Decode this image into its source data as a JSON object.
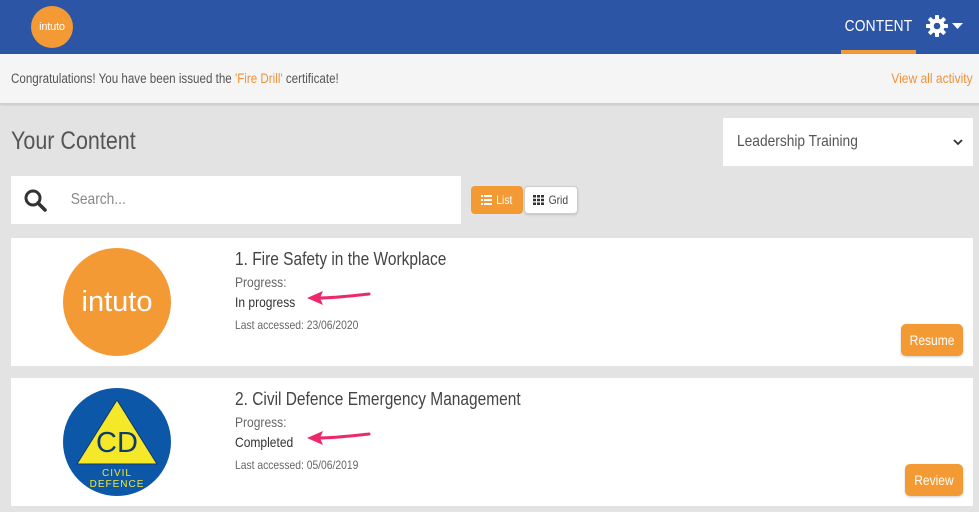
{
  "header": {
    "logo_text": "intuto",
    "nav_content": "CONTENT",
    "settings_icon": "gear-icon",
    "dropdown_icon": "caret-down-icon",
    "brand_color": "#2d55a5",
    "accent_color": "#f39a35"
  },
  "banner": {
    "prefix": "Congratulations! You have been issued the ",
    "certificate": "'Fire Drill'",
    "suffix": " certificate!",
    "view_all": "View all activity"
  },
  "main": {
    "title": "Your Content",
    "filter_selected": "Leadership Training",
    "search_placeholder": "Search...",
    "view_list": "List",
    "view_grid": "Grid"
  },
  "courses": [
    {
      "title": "1. Fire Safety in the Workplace",
      "progress_label": "Progress:",
      "progress_status": "In progress",
      "last_accessed": "Last accessed: 23/06/2020",
      "action": "Resume",
      "logo_text": "intuto"
    },
    {
      "title": "2. Civil Defence Emergency Management",
      "progress_label": "Progress:",
      "progress_status": "Completed",
      "last_accessed": "Last accessed: 05/06/2019",
      "action": "Review",
      "logo_initials": "CD",
      "logo_line1": "CIVIL",
      "logo_line2": "DEFENCE"
    }
  ]
}
